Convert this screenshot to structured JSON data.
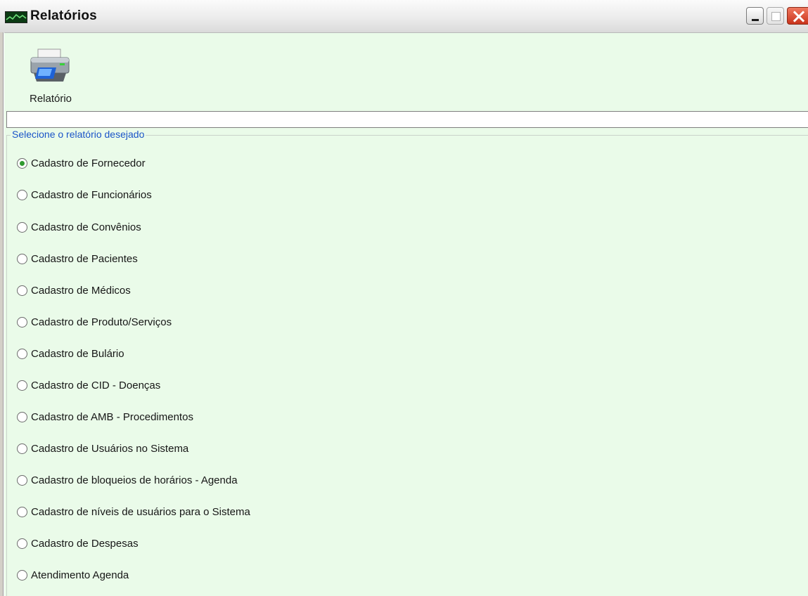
{
  "window": {
    "title": "Relatórios",
    "controls": [
      "minimize",
      "maximize",
      "close"
    ]
  },
  "toolbar": {
    "report_button_label": "Relatório",
    "report_icon": "printer-icon"
  },
  "report_group": {
    "legend": "Selecione o relatório desejado",
    "options": [
      {
        "label": "Cadastro de Fornecedor",
        "checked": true
      },
      {
        "label": "Cadastro de Funcionários",
        "checked": false
      },
      {
        "label": "Cadastro de Convênios",
        "checked": false
      },
      {
        "label": "Cadastro de Pacientes",
        "checked": false
      },
      {
        "label": "Cadastro de Médicos",
        "checked": false
      },
      {
        "label": "Cadastro de Produto/Serviços",
        "checked": false
      },
      {
        "label": "Cadastro de Bulário",
        "checked": false
      },
      {
        "label": "Cadastro de CID - Doenças",
        "checked": false
      },
      {
        "label": "Cadastro de AMB - Procedimentos",
        "checked": false
      },
      {
        "label": "Cadastro de Usuários no Sistema",
        "checked": false
      },
      {
        "label": "Cadastro de bloqueios de horários - Agenda",
        "checked": false
      },
      {
        "label": "Cadastro de níveis de usuários para o Sistema",
        "checked": false
      },
      {
        "label": "Cadastro de Despesas",
        "checked": false
      },
      {
        "label": "Atendimento Agenda",
        "checked": false
      }
    ]
  },
  "colors": {
    "window_background": "#eafbe9",
    "legend_text": "#1b54c8",
    "radio_checked_dot": "#2f9a2f",
    "close_button": "#d9472b"
  }
}
